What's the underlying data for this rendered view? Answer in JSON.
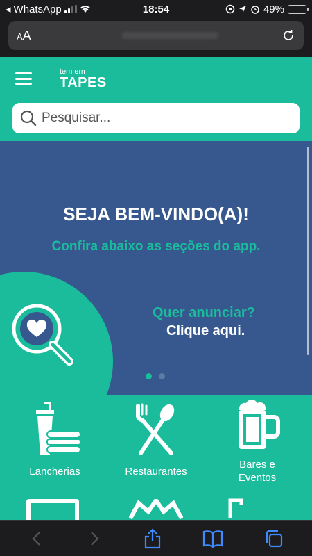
{
  "statusbar": {
    "back_app": "WhatsApp",
    "time": "18:54",
    "battery": "49%",
    "battery_level": 0.49
  },
  "browser": {
    "text_size_label": "AA"
  },
  "app": {
    "logo_small": "tem em",
    "logo_big": "TAPES",
    "search": {
      "placeholder": "Pesquisar..."
    },
    "hero": {
      "title": "SEJA BEM-VINDO(A)!",
      "subtitle": "Confira abaixo as seções do app.",
      "ad_question": "Quer anunciar?",
      "ad_action": "Clique aqui.",
      "slides": 2,
      "active_slide": 0
    },
    "categories": [
      {
        "label": "Lancherias",
        "icon": "fast-food-icon"
      },
      {
        "label": "Restaurantes",
        "icon": "fork-spoon-icon"
      },
      {
        "label_line1": "Bares e",
        "label_line2": "Eventos",
        "icon": "beer-mug-icon"
      }
    ]
  },
  "colors": {
    "teal": "#1abc9c",
    "navy": "#37588f",
    "chrome": "#1c1c1e"
  }
}
